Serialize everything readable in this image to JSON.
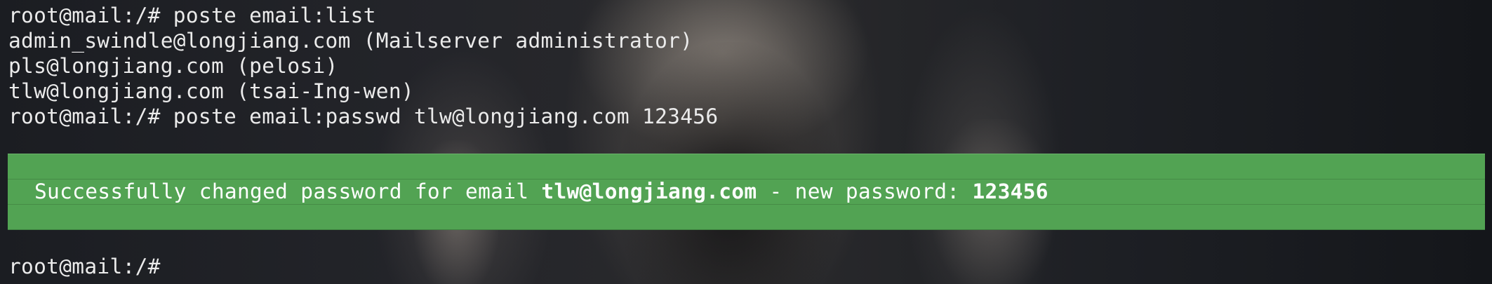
{
  "terminal": {
    "lines": [
      "root@mail:/# poste email:list",
      "admin_swindle@longjiang.com (Mailserver administrator)",
      "pls@longjiang.com (pelosi)",
      "tlw@longjiang.com (tsai-Ing-wen)",
      "root@mail:/# poste email:passwd tlw@longjiang.com 123456"
    ],
    "success": {
      "prefix": "Successfully changed password for email ",
      "email": "tlw@longjiang.com",
      "middle": " - new password: ",
      "password": "123456",
      "background_color": "#52a353"
    },
    "prompt": "root@mail:/#",
    "text_color": "#ebebeb"
  }
}
